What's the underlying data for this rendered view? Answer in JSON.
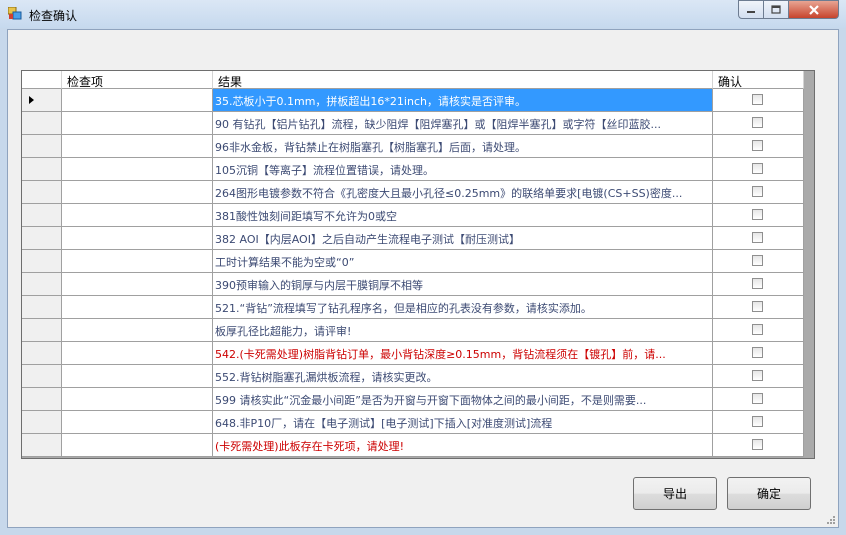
{
  "window": {
    "title": "检查确认"
  },
  "grid": {
    "columns": [
      "检查项",
      "结果",
      "确认"
    ],
    "rows": [
      {
        "item": "",
        "result": "35.芯板小于0.1mm，拼板超出16*21inch，请核实是否评审。",
        "checked": false,
        "selected": true,
        "red": false
      },
      {
        "item": "",
        "result": "90 有钻孔【铝片钻孔】流程，缺少阻焊【阻焊塞孔】或【阻焊半塞孔】或字符【丝印蓝胶...",
        "checked": false,
        "selected": false,
        "red": false
      },
      {
        "item": "",
        "result": "96非水金板，背钻禁止在树脂塞孔【树脂塞孔】后面，请处理。",
        "checked": false,
        "selected": false,
        "red": false
      },
      {
        "item": "",
        "result": "105沉铜【等离子】流程位置错误，请处理。",
        "checked": false,
        "selected": false,
        "red": false
      },
      {
        "item": "",
        "result": "264图形电镀参数不符合《孔密度大且最小孔径≤0.25mm》的联络单要求[电镀(CS+SS)密度...",
        "checked": false,
        "selected": false,
        "red": false
      },
      {
        "item": "",
        "result": "381酸性蚀刻间距填写不允许为0或空",
        "checked": false,
        "selected": false,
        "red": false
      },
      {
        "item": "",
        "result": "382 AOI【内层AOI】之后自动产生流程电子测试【耐压测试】",
        "checked": false,
        "selected": false,
        "red": false
      },
      {
        "item": "",
        "result": "工时计算结果不能为空或“0”",
        "checked": false,
        "selected": false,
        "red": false
      },
      {
        "item": "",
        "result": "390预审输入的铜厚与内层干膜铜厚不相等",
        "checked": false,
        "selected": false,
        "red": false
      },
      {
        "item": "",
        "result": "521.“背钻”流程填写了钻孔程序名，但是相应的孔表没有参数，请核实添加。",
        "checked": false,
        "selected": false,
        "red": false
      },
      {
        "item": "",
        "result": "板厚孔径比超能力，请评审!",
        "checked": false,
        "selected": false,
        "red": false
      },
      {
        "item": "",
        "result": "542.(卡死需处理)树脂背钻订单，最小背钻深度≥0.15mm，背钻流程须在【镀孔】前，请...",
        "checked": false,
        "selected": false,
        "red": true
      },
      {
        "item": "",
        "result": "552.背钻树脂塞孔漏烘板流程，请核实更改。",
        "checked": false,
        "selected": false,
        "red": false
      },
      {
        "item": "",
        "result": "599 请核实此“沉金最小间距”是否为开窗与开窗下面物体之间的最小间距，不是则需要...",
        "checked": false,
        "selected": false,
        "red": false
      },
      {
        "item": "",
        "result": "648.非P10厂，请在【电子测试】[电子测试]下插入[对准度测试]流程",
        "checked": false,
        "selected": false,
        "red": false
      },
      {
        "item": "",
        "result": "(卡死需处理)此板存在卡死项，请处理!",
        "checked": false,
        "selected": false,
        "red": true
      }
    ]
  },
  "buttons": {
    "export": "导出",
    "confirm": "确定"
  },
  "colors": {
    "selection": "#3399ff",
    "text": "#3c4a73",
    "error_text": "#cc0000"
  }
}
